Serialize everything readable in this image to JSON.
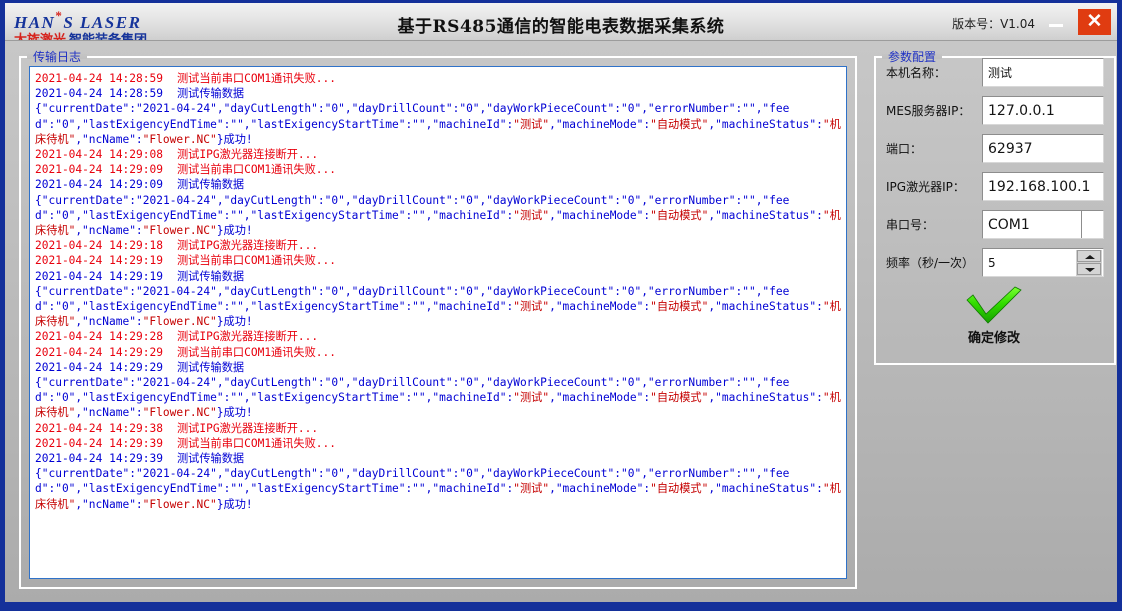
{
  "window": {
    "logo_en": "HAN",
    "logo_en2": "S LASER",
    "logo_star": "*",
    "logo_cn_red": "大族激光",
    "logo_cn_blue": "智能装备集团",
    "title": "基于RS485通信的智能电表数据采集系统",
    "version": "版本号：V1.04",
    "minimize_icon": "minimize-icon",
    "close_icon": "close-icon",
    "close_color": "#e03c11"
  },
  "log_panel": {
    "title": "传输日志",
    "colors": {
      "error": "#e8000d",
      "info": "#0000d4",
      "json_string": "#c50000"
    },
    "lines": [
      {
        "type": "error",
        "ts": "2021-04-24 14:28:59",
        "msg": "测试当前串口COM1通讯失败..."
      },
      {
        "type": "info",
        "ts": "2021-04-24 14:28:59",
        "msg": "测试传输数据"
      },
      {
        "type": "json",
        "text": "{\"currentDate\":\"2021-04-24\",\"dayCutLength\":\"0\",\"dayDrillCount\":\"0\",\"dayWorkPieceCount\":\"0\",\"errorNumber\":\"\",\"feed\":\"0\",\"lastExigencyEndTime\":\"\",\"lastExigencyStartTime\":\"\",\"machineId\":\"测试\",\"machineMode\":\"自动模式\",\"machineStatus\":\"机床待机\",\"ncName\":\"Flower.NC\"}成功!"
      },
      {
        "type": "error",
        "ts": "2021-04-24 14:29:08",
        "msg": "测试IPG激光器连接断开..."
      },
      {
        "type": "error",
        "ts": "2021-04-24 14:29:09",
        "msg": "测试当前串口COM1通讯失败..."
      },
      {
        "type": "info",
        "ts": "2021-04-24 14:29:09",
        "msg": "测试传输数据"
      },
      {
        "type": "json",
        "text": "{\"currentDate\":\"2021-04-24\",\"dayCutLength\":\"0\",\"dayDrillCount\":\"0\",\"dayWorkPieceCount\":\"0\",\"errorNumber\":\"\",\"feed\":\"0\",\"lastExigencyEndTime\":\"\",\"lastExigencyStartTime\":\"\",\"machineId\":\"测试\",\"machineMode\":\"自动模式\",\"machineStatus\":\"机床待机\",\"ncName\":\"Flower.NC\"}成功!"
      },
      {
        "type": "error",
        "ts": "2021-04-24 14:29:18",
        "msg": "测试IPG激光器连接断开..."
      },
      {
        "type": "error",
        "ts": "2021-04-24 14:29:19",
        "msg": "测试当前串口COM1通讯失败..."
      },
      {
        "type": "info",
        "ts": "2021-04-24 14:29:19",
        "msg": "测试传输数据"
      },
      {
        "type": "json",
        "text": "{\"currentDate\":\"2021-04-24\",\"dayCutLength\":\"0\",\"dayDrillCount\":\"0\",\"dayWorkPieceCount\":\"0\",\"errorNumber\":\"\",\"feed\":\"0\",\"lastExigencyEndTime\":\"\",\"lastExigencyStartTime\":\"\",\"machineId\":\"测试\",\"machineMode\":\"自动模式\",\"machineStatus\":\"机床待机\",\"ncName\":\"Flower.NC\"}成功!"
      },
      {
        "type": "error",
        "ts": "2021-04-24 14:29:28",
        "msg": "测试IPG激光器连接断开..."
      },
      {
        "type": "error",
        "ts": "2021-04-24 14:29:29",
        "msg": "测试当前串口COM1通讯失败..."
      },
      {
        "type": "info",
        "ts": "2021-04-24 14:29:29",
        "msg": "测试传输数据"
      },
      {
        "type": "json",
        "text": "{\"currentDate\":\"2021-04-24\",\"dayCutLength\":\"0\",\"dayDrillCount\":\"0\",\"dayWorkPieceCount\":\"0\",\"errorNumber\":\"\",\"feed\":\"0\",\"lastExigencyEndTime\":\"\",\"lastExigencyStartTime\":\"\",\"machineId\":\"测试\",\"machineMode\":\"自动模式\",\"machineStatus\":\"机床待机\",\"ncName\":\"Flower.NC\"}成功!"
      },
      {
        "type": "error",
        "ts": "2021-04-24 14:29:38",
        "msg": "测试IPG激光器连接断开..."
      },
      {
        "type": "error",
        "ts": "2021-04-24 14:29:39",
        "msg": "测试当前串口COM1通讯失败..."
      },
      {
        "type": "info",
        "ts": "2021-04-24 14:29:39",
        "msg": "测试传输数据"
      },
      {
        "type": "json",
        "text": "{\"currentDate\":\"2021-04-24\",\"dayCutLength\":\"0\",\"dayDrillCount\":\"0\",\"dayWorkPieceCount\":\"0\",\"errorNumber\":\"\",\"feed\":\"0\",\"lastExigencyEndTime\":\"\",\"lastExigencyStartTime\":\"\",\"machineId\":\"测试\",\"machineMode\":\"自动模式\",\"machineStatus\":\"机床待机\",\"ncName\":\"Flower.NC\"}成功!"
      }
    ]
  },
  "param_panel": {
    "title": "参数配置",
    "fields": [
      {
        "label": "本机名称：",
        "value": "测试",
        "kind": "text",
        "small": true
      },
      {
        "label": "MES服务器IP：",
        "value": "127.0.0.1",
        "kind": "text",
        "small": false
      },
      {
        "label": "端口：",
        "value": "62937",
        "kind": "text",
        "small": false
      },
      {
        "label": "IPG激光器IP：",
        "value": "192.168.100.1",
        "kind": "text",
        "small": false
      },
      {
        "label": "串口号：",
        "value": "COM1",
        "kind": "combo",
        "small": false
      },
      {
        "label": "频率（秒/一次）",
        "value": "5",
        "kind": "spin",
        "small": true
      }
    ],
    "confirm": {
      "label": "确定修改",
      "icon": "green-check-icon",
      "color": "#2ecc12"
    }
  }
}
